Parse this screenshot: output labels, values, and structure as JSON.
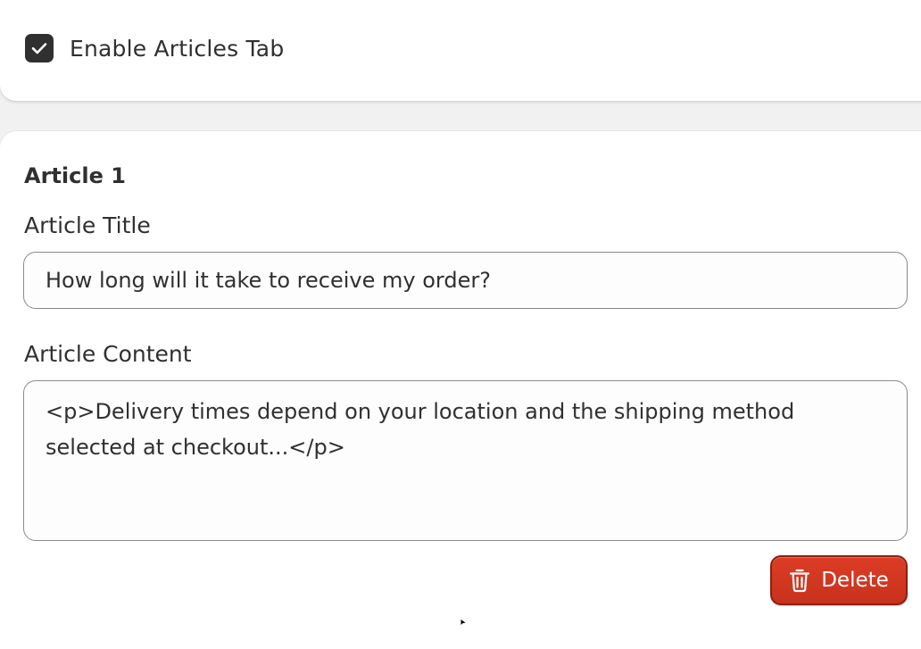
{
  "settings": {
    "enable_articles_tab": {
      "label": "Enable Articles Tab",
      "checked": true
    }
  },
  "article": {
    "heading": "Article 1",
    "title_label": "Article Title",
    "title_value": "How long will it take to receive my order?",
    "content_label": "Article Content",
    "content_value": "<p>Delivery times depend on your location and the shipping method selected at checkout...</p>",
    "delete_label": "Delete"
  },
  "icons": {
    "checkbox": "checkmark-icon",
    "delete": "trash-icon",
    "cursor": "mouse-pointer-icon"
  },
  "colors": {
    "checkbox_fill": "#303030",
    "delete_button": "#d53a22",
    "text": "#303030",
    "page_background": "#f1f1f1"
  }
}
